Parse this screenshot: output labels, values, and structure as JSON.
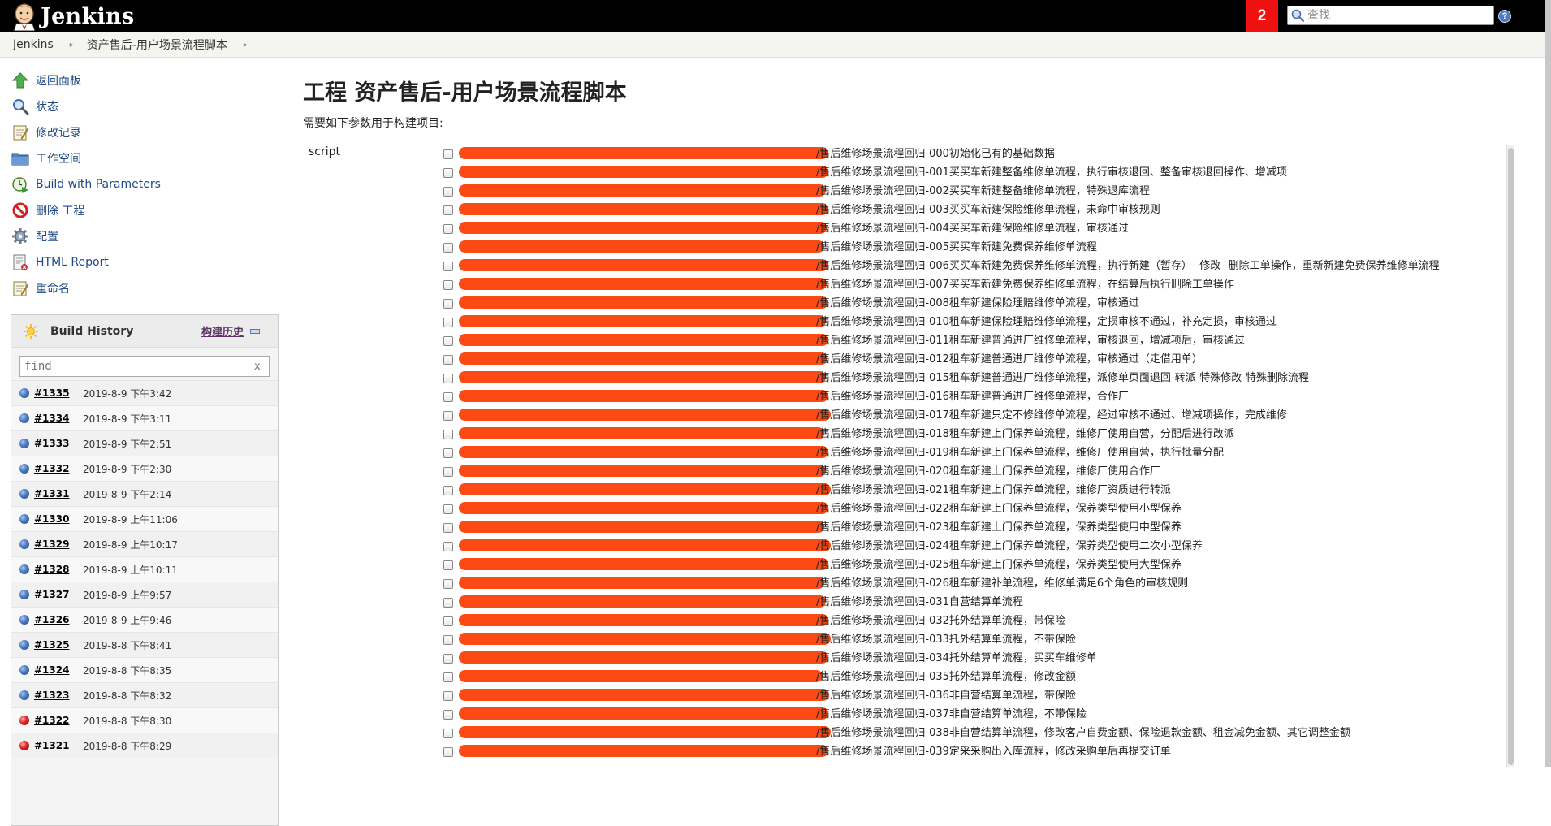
{
  "header": {
    "brand": "Jenkins",
    "alert_count": "2",
    "search_placeholder": "查找",
    "help_label": "?"
  },
  "breadcrumb": {
    "items": [
      "Jenkins",
      "资产售后-用户场景流程脚本"
    ]
  },
  "side_tasks": [
    {
      "label": "返回面板",
      "icon": "up-arrow-icon"
    },
    {
      "label": "状态",
      "icon": "magnifier-icon"
    },
    {
      "label": "修改记录",
      "icon": "notepad-icon"
    },
    {
      "label": "工作空间",
      "icon": "folder-icon"
    },
    {
      "label": "Build with Parameters",
      "icon": "clock-run-icon"
    },
    {
      "label": "删除 工程",
      "icon": "no-entry-icon"
    },
    {
      "label": "配置",
      "icon": "gear-icon"
    },
    {
      "label": "HTML Report",
      "icon": "report-icon"
    },
    {
      "label": "重命名",
      "icon": "notepad-icon"
    }
  ],
  "build_history": {
    "title": "Build History",
    "trend_label": "构建历史",
    "filter_placeholder": "find",
    "filter_clear": "x",
    "builds": [
      {
        "num": "#1335",
        "time": "2019-8-9 下午3:42",
        "status": "blue"
      },
      {
        "num": "#1334",
        "time": "2019-8-9 下午3:11",
        "status": "blue"
      },
      {
        "num": "#1333",
        "time": "2019-8-9 下午2:51",
        "status": "blue"
      },
      {
        "num": "#1332",
        "time": "2019-8-9 下午2:30",
        "status": "blue"
      },
      {
        "num": "#1331",
        "time": "2019-8-9 下午2:14",
        "status": "blue"
      },
      {
        "num": "#1330",
        "time": "2019-8-9 上午11:06",
        "status": "blue"
      },
      {
        "num": "#1329",
        "time": "2019-8-9 上午10:17",
        "status": "blue"
      },
      {
        "num": "#1328",
        "time": "2019-8-9 上午10:11",
        "status": "blue"
      },
      {
        "num": "#1327",
        "time": "2019-8-9 上午9:57",
        "status": "blue"
      },
      {
        "num": "#1326",
        "time": "2019-8-9 上午9:46",
        "status": "blue"
      },
      {
        "num": "#1325",
        "time": "2019-8-8 下午8:41",
        "status": "blue"
      },
      {
        "num": "#1324",
        "time": "2019-8-8 下午8:35",
        "status": "blue"
      },
      {
        "num": "#1323",
        "time": "2019-8-8 下午8:32",
        "status": "blue"
      },
      {
        "num": "#1322",
        "time": "2019-8-8 下午8:30",
        "status": "red"
      },
      {
        "num": "#1321",
        "time": "2019-8-8 下午8:29",
        "status": "red"
      }
    ]
  },
  "main": {
    "title": "工程 资产售后-用户场景流程脚本",
    "subtitle": "需要如下参数用于构建项目:",
    "param_name": "script",
    "scripts": [
      "/售后维修场景流程回归-000初始化已有的基础数据",
      "/售后维修场景流程回归-001买买车新建整备维修单流程，执行审核退回、整备审核退回操作、增减项",
      "/售后维修场景流程回归-002买买车新建整备维修单流程，特殊退库流程",
      "/售后维修场景流程回归-003买买车新建保险维修单流程，未命中审核规则",
      "/售后维修场景流程回归-004买买车新建保险维修单流程，审核通过",
      "/售后维修场景流程回归-005买买车新建免费保养维修单流程",
      "/售后维修场景流程回归-006买买车新建免费保养维修单流程，执行新建（暂存）--修改--删除工单操作，重新新建免费保养维修单流程",
      "/售后维修场景流程回归-007买买车新建免费保养维修单流程，在结算后执行删除工单操作",
      "/售后维修场景流程回归-008租车新建保险理赔维修单流程，审核通过",
      "/售后维修场景流程回归-010租车新建保险理赔维修单流程，定损审核不通过，补充定损，审核通过",
      "/售后维修场景流程回归-011租车新建普通进厂维修单流程，审核退回，增减项后，审核通过",
      "/售后维修场景流程回归-012租车新建普通进厂维修单流程，审核通过（走借用单）",
      "/售后维修场景流程回归-015租车新建普通进厂维修单流程，派修单页面退回-转派-特殊修改-特殊删除流程",
      "/售后维修场景流程回归-016租车新建普通进厂维修单流程，合作厂",
      "/售后维修场景流程回归-017租车新建只定不修维修单流程，经过审核不通过、增减项操作，完成维修",
      "/售后维修场景流程回归-018租车新建上门保养单流程，维修厂使用自营，分配后进行改派",
      "/售后维修场景流程回归-019租车新建上门保养单流程，维修厂使用自营，执行批量分配",
      "/售后维修场景流程回归-020租车新建上门保养单流程，维修厂使用合作厂",
      "/售后维修场景流程回归-021租车新建上门保养单流程，维修厂资质进行转派",
      "/售后维修场景流程回归-022租车新建上门保养单流程，保养类型使用小型保养",
      "/售后维修场景流程回归-023租车新建上门保养单流程，保养类型使用中型保养",
      "/售后维修场景流程回归-024租车新建上门保养单流程，保养类型使用二次小型保养",
      "/售后维修场景流程回归-025租车新建上门保养单流程，保养类型使用大型保养",
      "/售后维修场景流程回归-026租车新建补单流程，维修单满足6个角色的审核规则",
      "/售后维修场景流程回归-031自营结算单流程",
      "/售后维修场景流程回归-032托外结算单流程，带保险",
      "/售后维修场景流程回归-033托外结算单流程，不带保险",
      "/售后维修场景流程回归-034托外结算单流程，买买车维修单",
      "/售后维修场景流程回归-035托外结算单流程，修改金额",
      "/售后维修场景流程回归-036非自营结算单流程，带保险",
      "/售后维修场景流程回归-037非自营结算单流程，不带保险",
      "/售后维修场景流程回归-038非自营结算单流程，修改客户自费金额、保险退款金额、租金减免金额、其它调整金额",
      "/售后维修场景流程回归-039定采采购出入库流程，修改采购单后再提交订单"
    ]
  },
  "colors": {
    "header_bg": "#000000",
    "alert_bg": "#ee1111",
    "link": "#204a87",
    "redaction": "#fb4a14"
  }
}
